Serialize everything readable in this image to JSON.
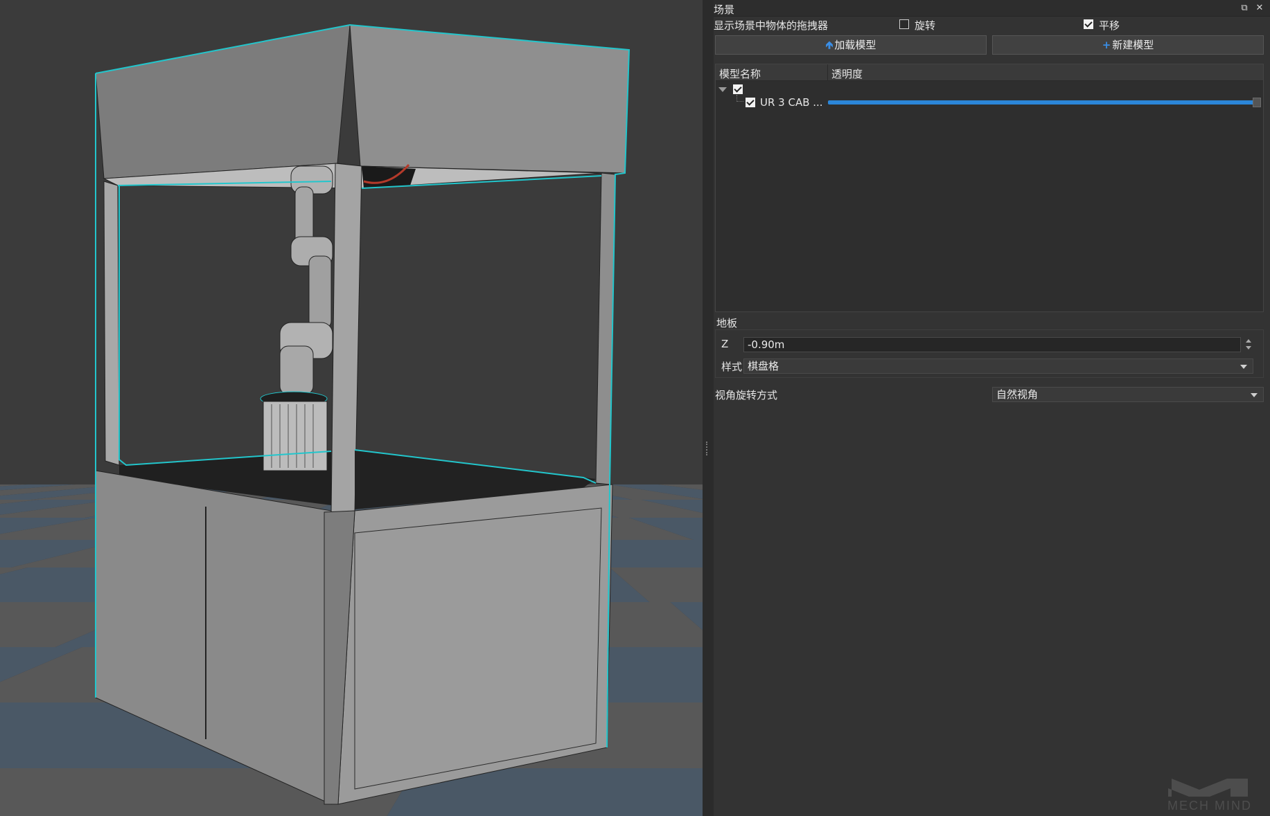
{
  "panel": {
    "title": "场景",
    "float_icon": "restore-icon",
    "close_icon": "close-icon",
    "dragger": {
      "label": "显示场景中物体的拖拽器",
      "rotate": {
        "label": "旋转",
        "checked": false
      },
      "translate": {
        "label": "平移",
        "checked": true
      }
    },
    "buttons": {
      "load_model": {
        "icon": "cursor-arrow-icon",
        "label": "加载模型"
      },
      "new_model": {
        "icon": "plus-icon",
        "label": "新建模型"
      }
    },
    "model_list": {
      "columns": [
        "模型名称",
        "透明度"
      ],
      "root": {
        "expanded": true,
        "checked": true
      },
      "items": [
        {
          "name": "UR 3 CAB ...",
          "checked": true,
          "opacity": 1.0
        }
      ]
    },
    "floor": {
      "section_label": "地板",
      "z_label": "Z",
      "z_value": "-0.90m",
      "style_label": "样式",
      "style_value": "棋盘格"
    },
    "view_rotation": {
      "label": "视角旋转方式",
      "value": "自然视角"
    }
  },
  "viewport": {
    "scene_content": "3d-robot-cell-viewport",
    "highlight_color": "#22c6cc",
    "floor_colors": [
      "#4a5866",
      "#585858"
    ],
    "background_color": "#3b3b3b"
  },
  "watermark": {
    "text": "MECH MIND"
  },
  "colors": {
    "accent": "#2b86d8",
    "panel_bg": "#333333"
  }
}
